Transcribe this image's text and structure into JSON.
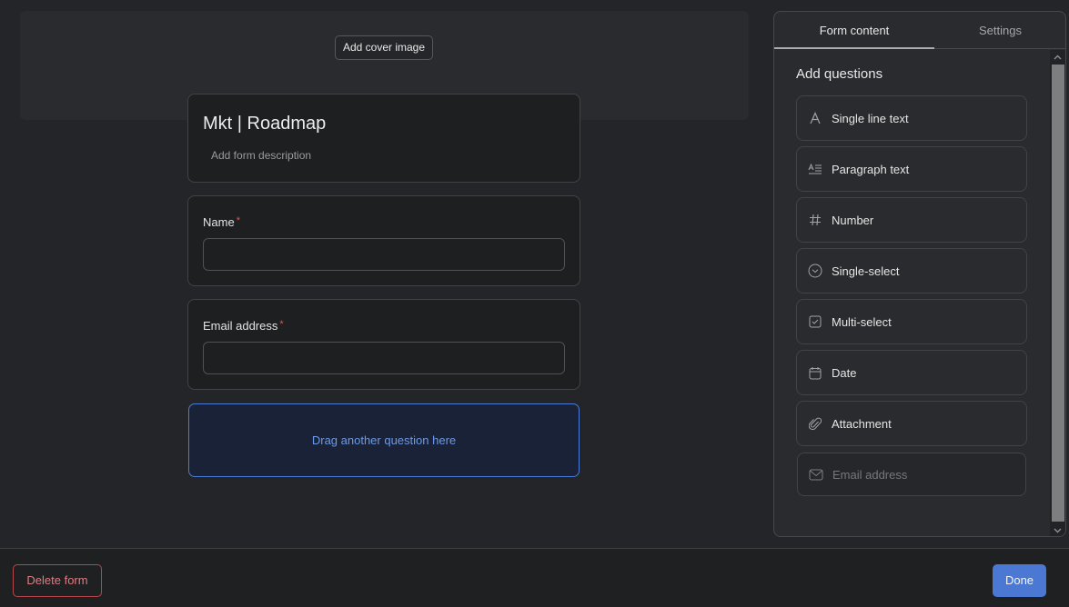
{
  "cover": {
    "add_cover_label": "Add cover image"
  },
  "form": {
    "title": "Mkt | Roadmap",
    "description_placeholder": "Add form description",
    "questions": [
      {
        "label": "Name",
        "required_mark": "*",
        "value": ""
      },
      {
        "label": "Email address",
        "required_mark": "*",
        "value": ""
      }
    ],
    "dropzone_label": "Drag another question here"
  },
  "panel": {
    "tabs": [
      {
        "label": "Form content",
        "active": true
      },
      {
        "label": "Settings",
        "active": false
      }
    ],
    "heading": "Add questions",
    "question_types": [
      {
        "label": "Single line text",
        "icon": "text-a-icon",
        "enabled": true
      },
      {
        "label": "Paragraph text",
        "icon": "paragraph-icon",
        "enabled": true
      },
      {
        "label": "Number",
        "icon": "hash-icon",
        "enabled": true
      },
      {
        "label": "Single-select",
        "icon": "circle-chevron-down-icon",
        "enabled": true
      },
      {
        "label": "Multi-select",
        "icon": "checkbox-icon",
        "enabled": true
      },
      {
        "label": "Date",
        "icon": "calendar-icon",
        "enabled": true
      },
      {
        "label": "Attachment",
        "icon": "paperclip-icon",
        "enabled": true
      },
      {
        "label": "Email address",
        "icon": "envelope-icon",
        "enabled": false
      }
    ]
  },
  "footer": {
    "delete_label": "Delete form",
    "done_label": "Done"
  },
  "colors": {
    "accent": "#4a78d3",
    "danger": "#b8474b",
    "required": "#e0524f",
    "dropzone_text": "#6e9ae6"
  }
}
